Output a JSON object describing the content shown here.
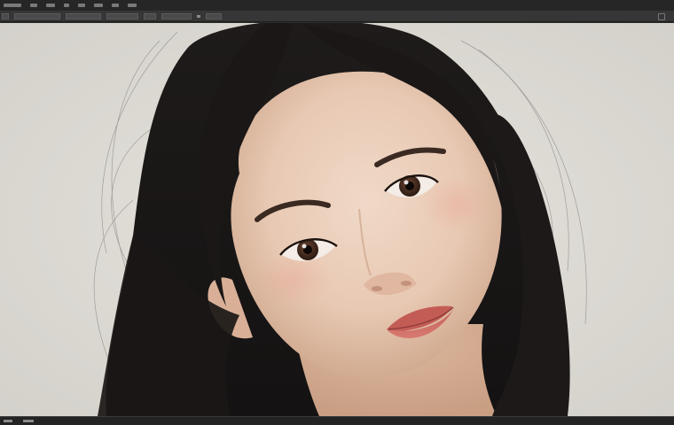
{
  "window": {
    "menu_items": [
      "",
      "",
      "",
      "",
      "",
      "",
      "",
      ""
    ],
    "options_bar": {
      "fields": [
        "",
        "",
        "",
        "",
        "",
        ""
      ]
    },
    "status_bar": {
      "zoom": "",
      "doc_info": ""
    }
  },
  "canvas": {
    "image_subject": "portrait",
    "background_color": "#dedbd5"
  },
  "colors": {
    "menubar": "#262626",
    "optionsbar": "#363636",
    "workspace": "#2b2b2b"
  }
}
